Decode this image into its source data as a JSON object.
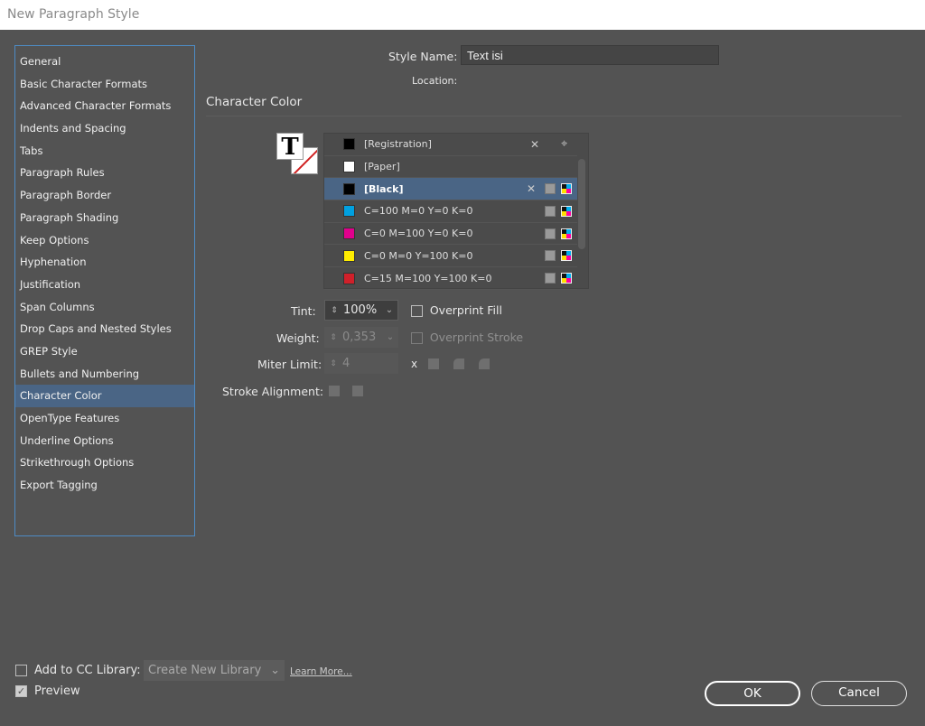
{
  "window": {
    "title": "New Paragraph Style"
  },
  "sidebar": {
    "items": [
      {
        "label": "General"
      },
      {
        "label": "Basic Character Formats"
      },
      {
        "label": "Advanced Character Formats"
      },
      {
        "label": "Indents and Spacing"
      },
      {
        "label": "Tabs"
      },
      {
        "label": "Paragraph Rules"
      },
      {
        "label": "Paragraph Border"
      },
      {
        "label": "Paragraph Shading"
      },
      {
        "label": "Keep Options"
      },
      {
        "label": "Hyphenation"
      },
      {
        "label": "Justification"
      },
      {
        "label": "Span Columns"
      },
      {
        "label": "Drop Caps and Nested Styles"
      },
      {
        "label": "GREP Style"
      },
      {
        "label": "Bullets and Numbering"
      },
      {
        "label": "Character Color",
        "selected": true
      },
      {
        "label": "OpenType Features"
      },
      {
        "label": "Underline Options"
      },
      {
        "label": "Strikethrough Options"
      },
      {
        "label": "Export Tagging"
      }
    ],
    "selected_color": "#4a6585"
  },
  "header": {
    "style_name_label": "Style Name:",
    "style_name_value": "Text isi",
    "location_label": "Location:"
  },
  "section": {
    "title": "Character Color"
  },
  "swatches": [
    {
      "name": "[Registration]",
      "color": "#000000",
      "icons": [
        "no-edit",
        "registration"
      ]
    },
    {
      "name": "[Paper]",
      "color": "#ffffff",
      "icons": []
    },
    {
      "name": "[Black]",
      "color": "#000000",
      "selected": true,
      "icons": [
        "no-edit",
        "process",
        "cmyk"
      ]
    },
    {
      "name": "C=100 M=0 Y=0 K=0",
      "color": "#00a0e0",
      "icons": [
        "process",
        "cmyk"
      ]
    },
    {
      "name": "C=0 M=100 Y=0 K=0",
      "color": "#e0008c",
      "icons": [
        "process",
        "cmyk"
      ]
    },
    {
      "name": "C=0 M=0 Y=100 K=0",
      "color": "#ffed00",
      "icons": [
        "process",
        "cmyk"
      ]
    },
    {
      "name": "C=15 M=100 Y=100 K=0",
      "color": "#d0202a",
      "icons": [
        "process",
        "cmyk"
      ]
    }
  ],
  "fields": {
    "tint_label": "Tint:",
    "tint_value": "100%",
    "overprint_fill": "Overprint Fill",
    "weight_label": "Weight:",
    "weight_value": "0,353",
    "overprint_stroke": "Overprint Stroke",
    "miter_label": "Miter Limit:",
    "miter_value": "4",
    "miter_x": "x",
    "stroke_align_label": "Stroke Alignment:"
  },
  "footer": {
    "cc_label": "Add to CC Library:",
    "cc_checked": false,
    "library_value": "Create New Library",
    "learn_more": "Learn More...",
    "preview_label": "Preview",
    "preview_checked": true,
    "ok": "OK",
    "cancel": "Cancel"
  }
}
